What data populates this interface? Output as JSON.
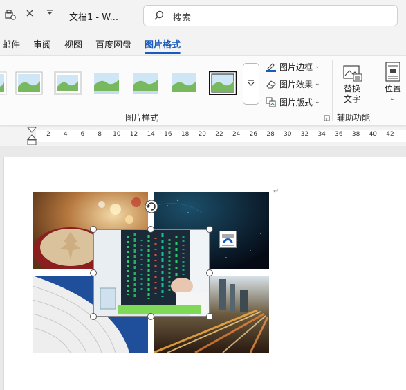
{
  "titlebar": {
    "doc_title": "文档1 - W...",
    "search_placeholder": "搜索"
  },
  "tabs": [
    {
      "label": "邮件",
      "active": false
    },
    {
      "label": "审阅",
      "active": false
    },
    {
      "label": "视图",
      "active": false
    },
    {
      "label": "百度网盘",
      "active": false
    },
    {
      "label": "图片格式",
      "active": true
    }
  ],
  "ribbon": {
    "picture_styles_label": "图片样式",
    "border_label": "图片边框",
    "effects_label": "图片效果",
    "layout_label": "图片版式",
    "alt_text_label_1": "替换",
    "alt_text_label_2": "文字",
    "accessibility_label": "辅助功能",
    "position_label": "位置"
  },
  "ruler": {
    "numbers": [
      "2",
      "4",
      "6",
      "8",
      "10",
      "12",
      "14",
      "16",
      "18",
      "20",
      "22",
      "24",
      "26",
      "28",
      "30",
      "32",
      "34",
      "36",
      "38",
      "40",
      "42"
    ]
  },
  "document": {
    "paragraph_mark": "↵"
  },
  "colors": {
    "accent": "#185abd"
  }
}
